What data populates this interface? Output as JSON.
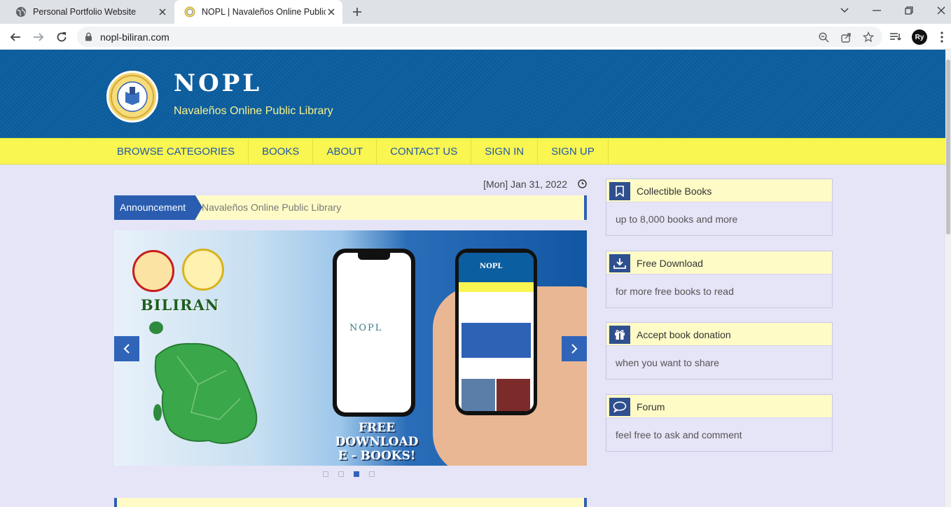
{
  "browser": {
    "tabs": [
      {
        "title": "Personal Portfolio Website",
        "active": false,
        "icon": "globe-icon"
      },
      {
        "title": "NOPL | Navaleños Online Public Library",
        "active": true,
        "icon": "nopl-seal-icon"
      }
    ],
    "url": "nopl-biliran.com",
    "profile_initial": "Ry"
  },
  "site": {
    "title": "NOPL",
    "subtitle": "Navaleños Online Public Library",
    "colors": {
      "header": "#0b5ea0",
      "nav": "#f9f551",
      "accent": "#2a5db0",
      "background": "#e6e4f7"
    }
  },
  "nav": {
    "items": [
      "BROWSE CATEGORIES",
      "BOOKS",
      "ABOUT",
      "CONTACT US",
      "SIGN IN",
      "SIGN UP"
    ]
  },
  "main": {
    "date": "[Mon] Jan 31, 2022",
    "announcement": {
      "label": "Announcement",
      "text": "Navaleños Online Public Library"
    },
    "slider": {
      "heading": "BILIRAN",
      "caption_line1": "FREE DOWNLOAD",
      "caption_line2": "E - BOOKS!",
      "phone_logo": "NOPL",
      "phone2_title": "NOPL",
      "dots": 4,
      "active_dot": 3
    }
  },
  "sidebar": {
    "cards": [
      {
        "title": "Collectible Books",
        "desc": "up to 8,000 books and more",
        "icon": "bookmark-icon"
      },
      {
        "title": "Free Download",
        "desc": "for more free books to read",
        "icon": "download-icon"
      },
      {
        "title": "Accept book donation",
        "desc": "when you want to share",
        "icon": "gift-icon"
      },
      {
        "title": "Forum",
        "desc": "feel free to ask and comment",
        "icon": "chat-bubble-icon"
      }
    ]
  }
}
